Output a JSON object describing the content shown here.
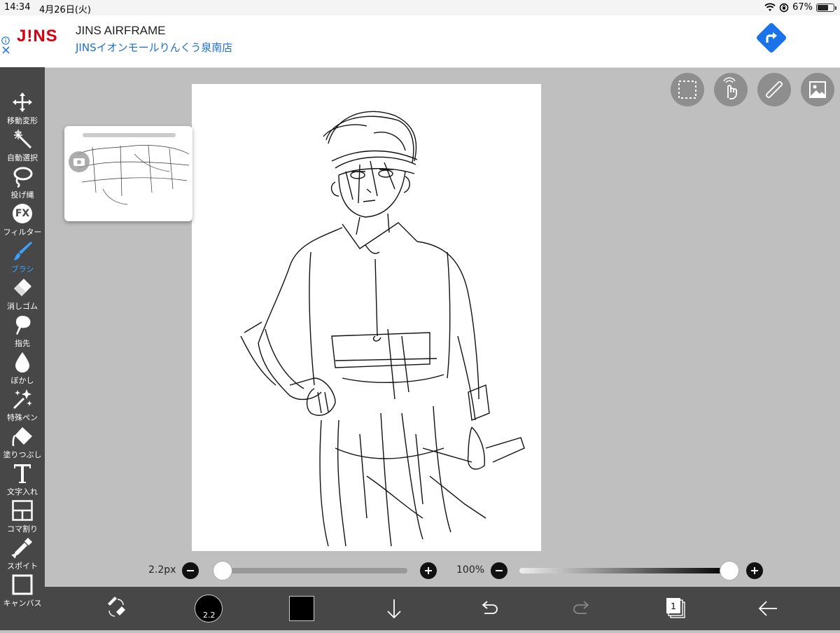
{
  "status_bar": {
    "time": "14:34",
    "date": "4月26日(火)",
    "battery": "67%"
  },
  "ad": {
    "logo": "J!NS",
    "title": "JINS AIRFRAME",
    "subtitle": "JINSイオンモールりんくう泉南店",
    "info_icon": "info-icon",
    "close_icon": "close-icon",
    "accent_color": "#1a73e8"
  },
  "tools": [
    {
      "label": "移動変形",
      "icon": "move-icon"
    },
    {
      "label": "自動選択",
      "icon": "magic-wand-icon"
    },
    {
      "label": "投げ縄",
      "icon": "lasso-icon"
    },
    {
      "label": "フィルター",
      "icon": "fx-icon"
    },
    {
      "label": "ブラシ",
      "icon": "brush-icon",
      "active": true
    },
    {
      "label": "消しゴム",
      "icon": "eraser-icon"
    },
    {
      "label": "指先",
      "icon": "smudge-icon"
    },
    {
      "label": "ぼかし",
      "icon": "blur-drop-icon"
    },
    {
      "label": "特殊ペン",
      "icon": "special-pen-icon"
    },
    {
      "label": "塗りつぶし",
      "icon": "fill-bucket-icon"
    },
    {
      "label": "文字入れ",
      "icon": "text-icon"
    },
    {
      "label": "コマ割り",
      "icon": "frame-divider-icon"
    },
    {
      "label": "スポイト",
      "icon": "eyedropper-icon"
    },
    {
      "label": "キャンバス",
      "icon": "canvas-icon"
    }
  ],
  "fx_label": "FX",
  "brush_size": {
    "label": "2.2px",
    "value_fraction": 0.0
  },
  "opacity": {
    "label": "100%",
    "value_fraction": 1.0
  },
  "bottom": {
    "brush_size_badge": "2.2",
    "layer_count": "1",
    "color": "#000000"
  },
  "colors": {
    "active_tool": "#3aa3ff",
    "toolbar_bg": "#474747",
    "workspace_bg": "#bfbfbf"
  }
}
